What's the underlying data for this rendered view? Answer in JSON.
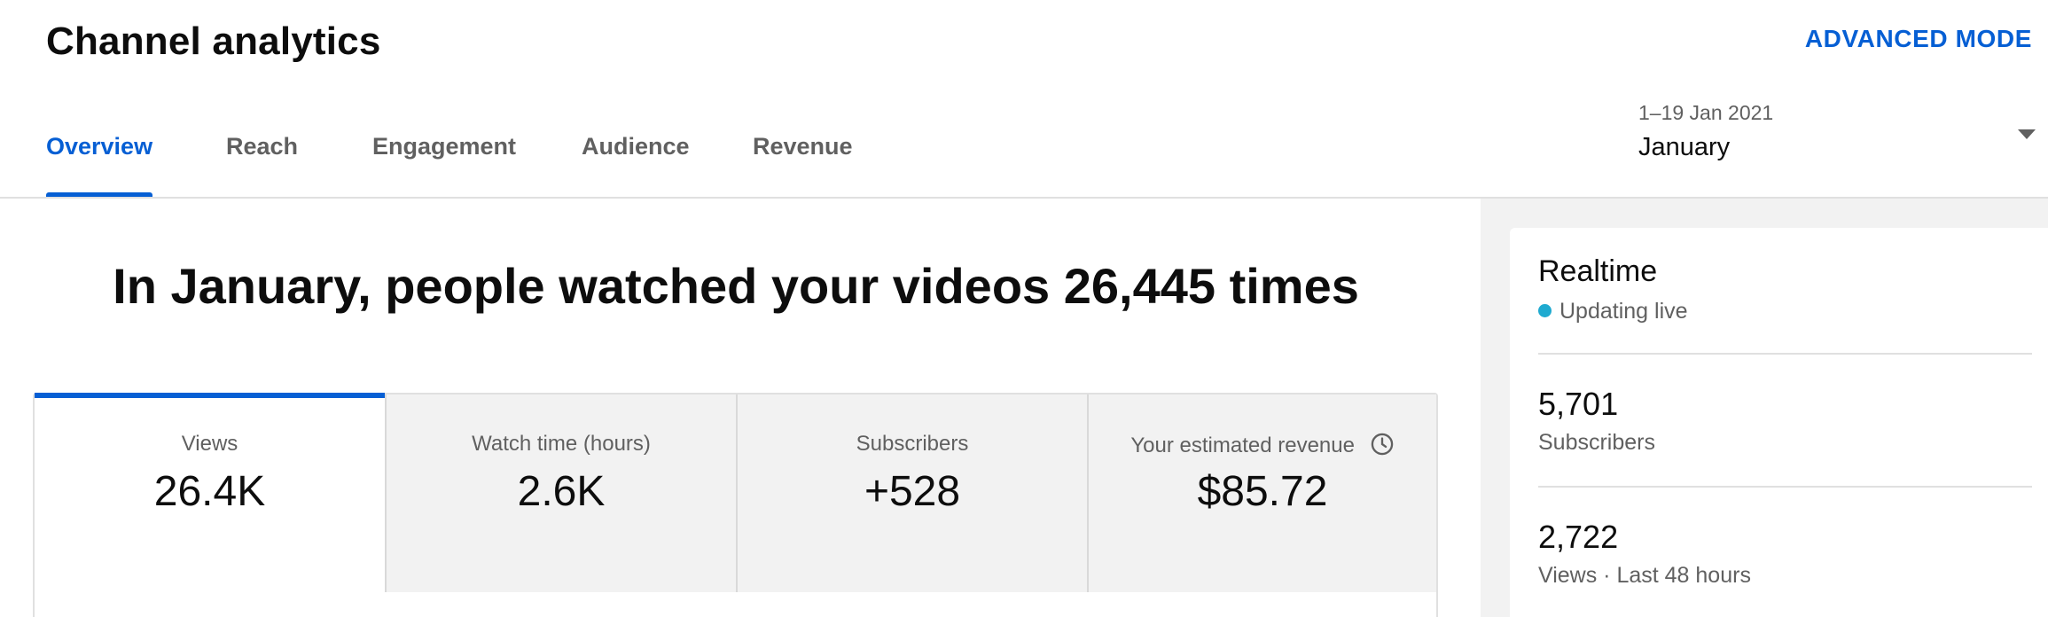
{
  "header": {
    "title": "Channel analytics",
    "advanced_mode": "ADVANCED MODE"
  },
  "tabs": [
    {
      "label": "Overview",
      "active": true
    },
    {
      "label": "Reach"
    },
    {
      "label": "Engagement"
    },
    {
      "label": "Audience"
    },
    {
      "label": "Revenue"
    }
  ],
  "date_picker": {
    "range": "1–19 Jan 2021",
    "value": "January"
  },
  "headline": "In January, people watched your videos 26,445 times",
  "metrics": [
    {
      "label": "Views",
      "value": "26.4K",
      "active": true
    },
    {
      "label": "Watch time (hours)",
      "value": "2.6K"
    },
    {
      "label": "Subscribers",
      "value": "+528"
    },
    {
      "label": "Your estimated revenue",
      "value": "$85.72",
      "icon": "clock-icon"
    }
  ],
  "realtime": {
    "title": "Realtime",
    "status": "Updating live",
    "status_color": "#1faad0",
    "stats": [
      {
        "value": "5,701",
        "label": "Subscribers"
      },
      {
        "value": "2,722",
        "label": "Views · Last 48 hours"
      }
    ]
  },
  "colors": {
    "accent": "#065fd4",
    "muted_text": "#606060",
    "panel_bg": "#f2f2f2"
  }
}
